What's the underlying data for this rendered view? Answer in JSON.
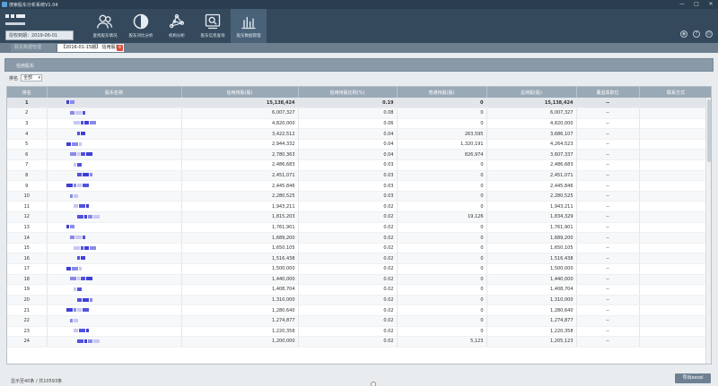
{
  "window": {
    "title": "搜索股东分析系统V1.04"
  },
  "header": {
    "auth_label": "授权到期：2019-06-01",
    "nav": [
      {
        "label": "查找股东情况",
        "icon": "users-icon"
      },
      {
        "label": "股东对比分析",
        "icon": "contrast-icon"
      },
      {
        "label": "机构分析",
        "icon": "network-icon"
      },
      {
        "label": "股东信息查询",
        "icon": "search-screen-icon"
      },
      {
        "label": "股东数据管理",
        "icon": "bar-chart-icon",
        "active": true
      }
    ]
  },
  "tabs": [
    {
      "label": "股东数据管理"
    },
    {
      "label": "【2016-01-15期】 信用股东",
      "closable": true,
      "active": true
    }
  ],
  "panel": {
    "title": "信用股东"
  },
  "filter": {
    "label": "排名",
    "value": "全部"
  },
  "table": {
    "columns": [
      "排名",
      "股东名称",
      "信用持股(股)",
      "信用持股比例(%)",
      "普通持股(股)",
      "总持股(股)",
      "董监高职位",
      "联系方式"
    ],
    "rows": [
      {
        "rank": "1",
        "credit": "15,138,424",
        "ratio": "0.19",
        "normal": "0",
        "total": "15,138,424",
        "pos": "--"
      },
      {
        "rank": "2",
        "credit": "6,007,327",
        "ratio": "0.08",
        "normal": "0",
        "total": "6,007,327",
        "pos": "--"
      },
      {
        "rank": "3",
        "credit": "4,820,000",
        "ratio": "0.06",
        "normal": "0",
        "total": "4,820,000",
        "pos": "--"
      },
      {
        "rank": "4",
        "credit": "3,422,512",
        "ratio": "0.04",
        "normal": "263,595",
        "total": "3,686,107",
        "pos": "--"
      },
      {
        "rank": "5",
        "credit": "2,944,332",
        "ratio": "0.04",
        "normal": "1,320,191",
        "total": "4,264,523",
        "pos": "--"
      },
      {
        "rank": "6",
        "credit": "2,780,363",
        "ratio": "0.04",
        "normal": "826,974",
        "total": "3,607,337",
        "pos": "--"
      },
      {
        "rank": "7",
        "credit": "2,486,683",
        "ratio": "0.03",
        "normal": "0",
        "total": "2,486,683",
        "pos": "--"
      },
      {
        "rank": "8",
        "credit": "2,451,071",
        "ratio": "0.03",
        "normal": "0",
        "total": "2,451,071",
        "pos": "--"
      },
      {
        "rank": "9",
        "credit": "2,445,846",
        "ratio": "0.03",
        "normal": "0",
        "total": "2,445,846",
        "pos": "--"
      },
      {
        "rank": "10",
        "credit": "2,280,525",
        "ratio": "0.03",
        "normal": "0",
        "total": "2,280,525",
        "pos": "--"
      },
      {
        "rank": "11",
        "credit": "1,943,211",
        "ratio": "0.02",
        "normal": "0",
        "total": "1,943,211",
        "pos": "--"
      },
      {
        "rank": "12",
        "credit": "1,815,203",
        "ratio": "0.02",
        "normal": "19,126",
        "total": "1,834,329",
        "pos": "--"
      },
      {
        "rank": "13",
        "credit": "1,761,901",
        "ratio": "0.02",
        "normal": "0",
        "total": "1,761,901",
        "pos": "--"
      },
      {
        "rank": "14",
        "credit": "1,689,200",
        "ratio": "0.02",
        "normal": "0",
        "total": "1,689,200",
        "pos": "--"
      },
      {
        "rank": "15",
        "credit": "1,650,105",
        "ratio": "0.02",
        "normal": "0",
        "total": "1,650,105",
        "pos": "--"
      },
      {
        "rank": "16",
        "credit": "1,516,438",
        "ratio": "0.02",
        "normal": "0",
        "total": "1,516,438",
        "pos": "--"
      },
      {
        "rank": "17",
        "credit": "1,500,000",
        "ratio": "0.02",
        "normal": "0",
        "total": "1,500,000",
        "pos": "--"
      },
      {
        "rank": "18",
        "credit": "1,440,000",
        "ratio": "0.02",
        "normal": "0",
        "total": "1,440,000",
        "pos": "--"
      },
      {
        "rank": "19",
        "credit": "1,408,704",
        "ratio": "0.02",
        "normal": "0",
        "total": "1,408,704",
        "pos": "--"
      },
      {
        "rank": "20",
        "credit": "1,310,000",
        "ratio": "0.02",
        "normal": "0",
        "total": "1,310,000",
        "pos": "--"
      },
      {
        "rank": "21",
        "credit": "1,280,640",
        "ratio": "0.02",
        "normal": "0",
        "total": "1,280,640",
        "pos": "--"
      },
      {
        "rank": "22",
        "credit": "1,274,877",
        "ratio": "0.02",
        "normal": "0",
        "total": "1,274,877",
        "pos": "--"
      },
      {
        "rank": "23",
        "credit": "1,220,358",
        "ratio": "0.02",
        "normal": "0",
        "total": "1,220,358",
        "pos": "--"
      },
      {
        "rank": "24",
        "credit": "1,200,000",
        "ratio": "0.02",
        "normal": "5,123",
        "total": "1,205,123",
        "pos": "--"
      }
    ]
  },
  "footer": {
    "info": "显示至40条 / 共10593条",
    "export_label": "导出excel"
  },
  "colors": {
    "titlebar": "#2b3e50",
    "header": "#34495c",
    "nav_active": "#4a6278",
    "table_head": "#9aa9b6",
    "close": "#e04a3a"
  }
}
